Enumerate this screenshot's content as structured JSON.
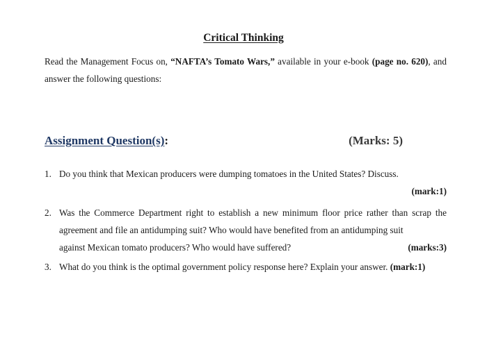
{
  "document": {
    "title": "Critical Thinking",
    "intro": {
      "part1": "Read the Management Focus on, ",
      "case_title": "“NAFTA’s Tomato Wars,”",
      "part2": " available in your e-book ",
      "page_ref": "(page no. 620)",
      "part3": ", and answer the following questions:"
    },
    "assignment": {
      "heading": "Assignment Question(s)",
      "colon": ":",
      "total_marks": "(Marks: 5)"
    },
    "questions": [
      {
        "number": "1.",
        "text": "Do you think that Mexican producers were dumping tomatoes in the United States? Discuss.",
        "marks": "(mark:1)"
      },
      {
        "number": "2.",
        "text_main": "Was the Commerce Department right to establish a new minimum floor price rather than scrap the agreement and file an antidumping suit? Who would have benefited from an antidumping suit",
        "text_last": "against Mexican tomato producers? Who would have suffered?",
        "marks": "(marks:3)"
      },
      {
        "number": "3.",
        "text": "What do you think is the optimal government policy response here? Explain your answer. ",
        "marks": "(mark:1)"
      }
    ]
  }
}
